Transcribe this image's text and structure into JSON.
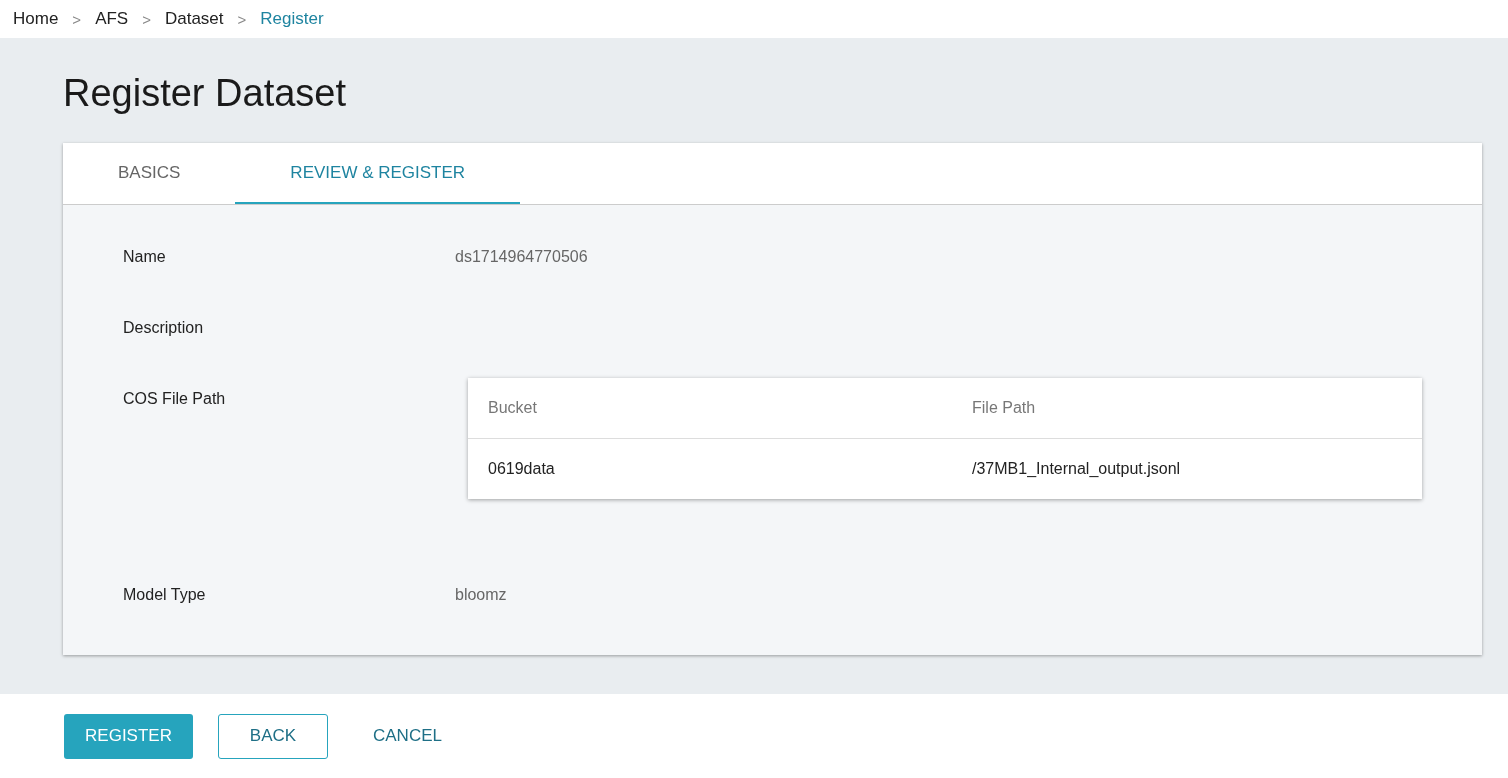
{
  "breadcrumb": [
    {
      "label": "Home",
      "current": false,
      "separator": ">"
    },
    {
      "label": "AFS",
      "current": false,
      "separator": ">"
    },
    {
      "label": "Dataset",
      "current": false,
      "separator": ">"
    },
    {
      "label": "Register",
      "current": true
    }
  ],
  "page_title": "Register Dataset",
  "tabs": [
    {
      "label": "BASICS",
      "selected": false
    },
    {
      "label": "REVIEW & REGISTER",
      "selected": true
    }
  ],
  "fields": [
    {
      "kind": "text",
      "label": "Name",
      "value": "ds1714964770506"
    },
    {
      "kind": "text",
      "label": "Description"
    },
    {
      "kind": "table",
      "label": "COS File Path",
      "table": {
        "columns": [
          "Bucket",
          "File Path"
        ],
        "rows": [
          [
            "0619data",
            "/37MB1_Internal_output.jsonl"
          ]
        ]
      }
    },
    {
      "kind": "text",
      "label": "Model Type",
      "value": "bloomz"
    }
  ],
  "buttons": [
    {
      "kind": "primary",
      "label": "REGISTER"
    },
    {
      "kind": "outline",
      "label": "BACK"
    },
    {
      "kind": "text",
      "label": "CANCEL"
    }
  ]
}
